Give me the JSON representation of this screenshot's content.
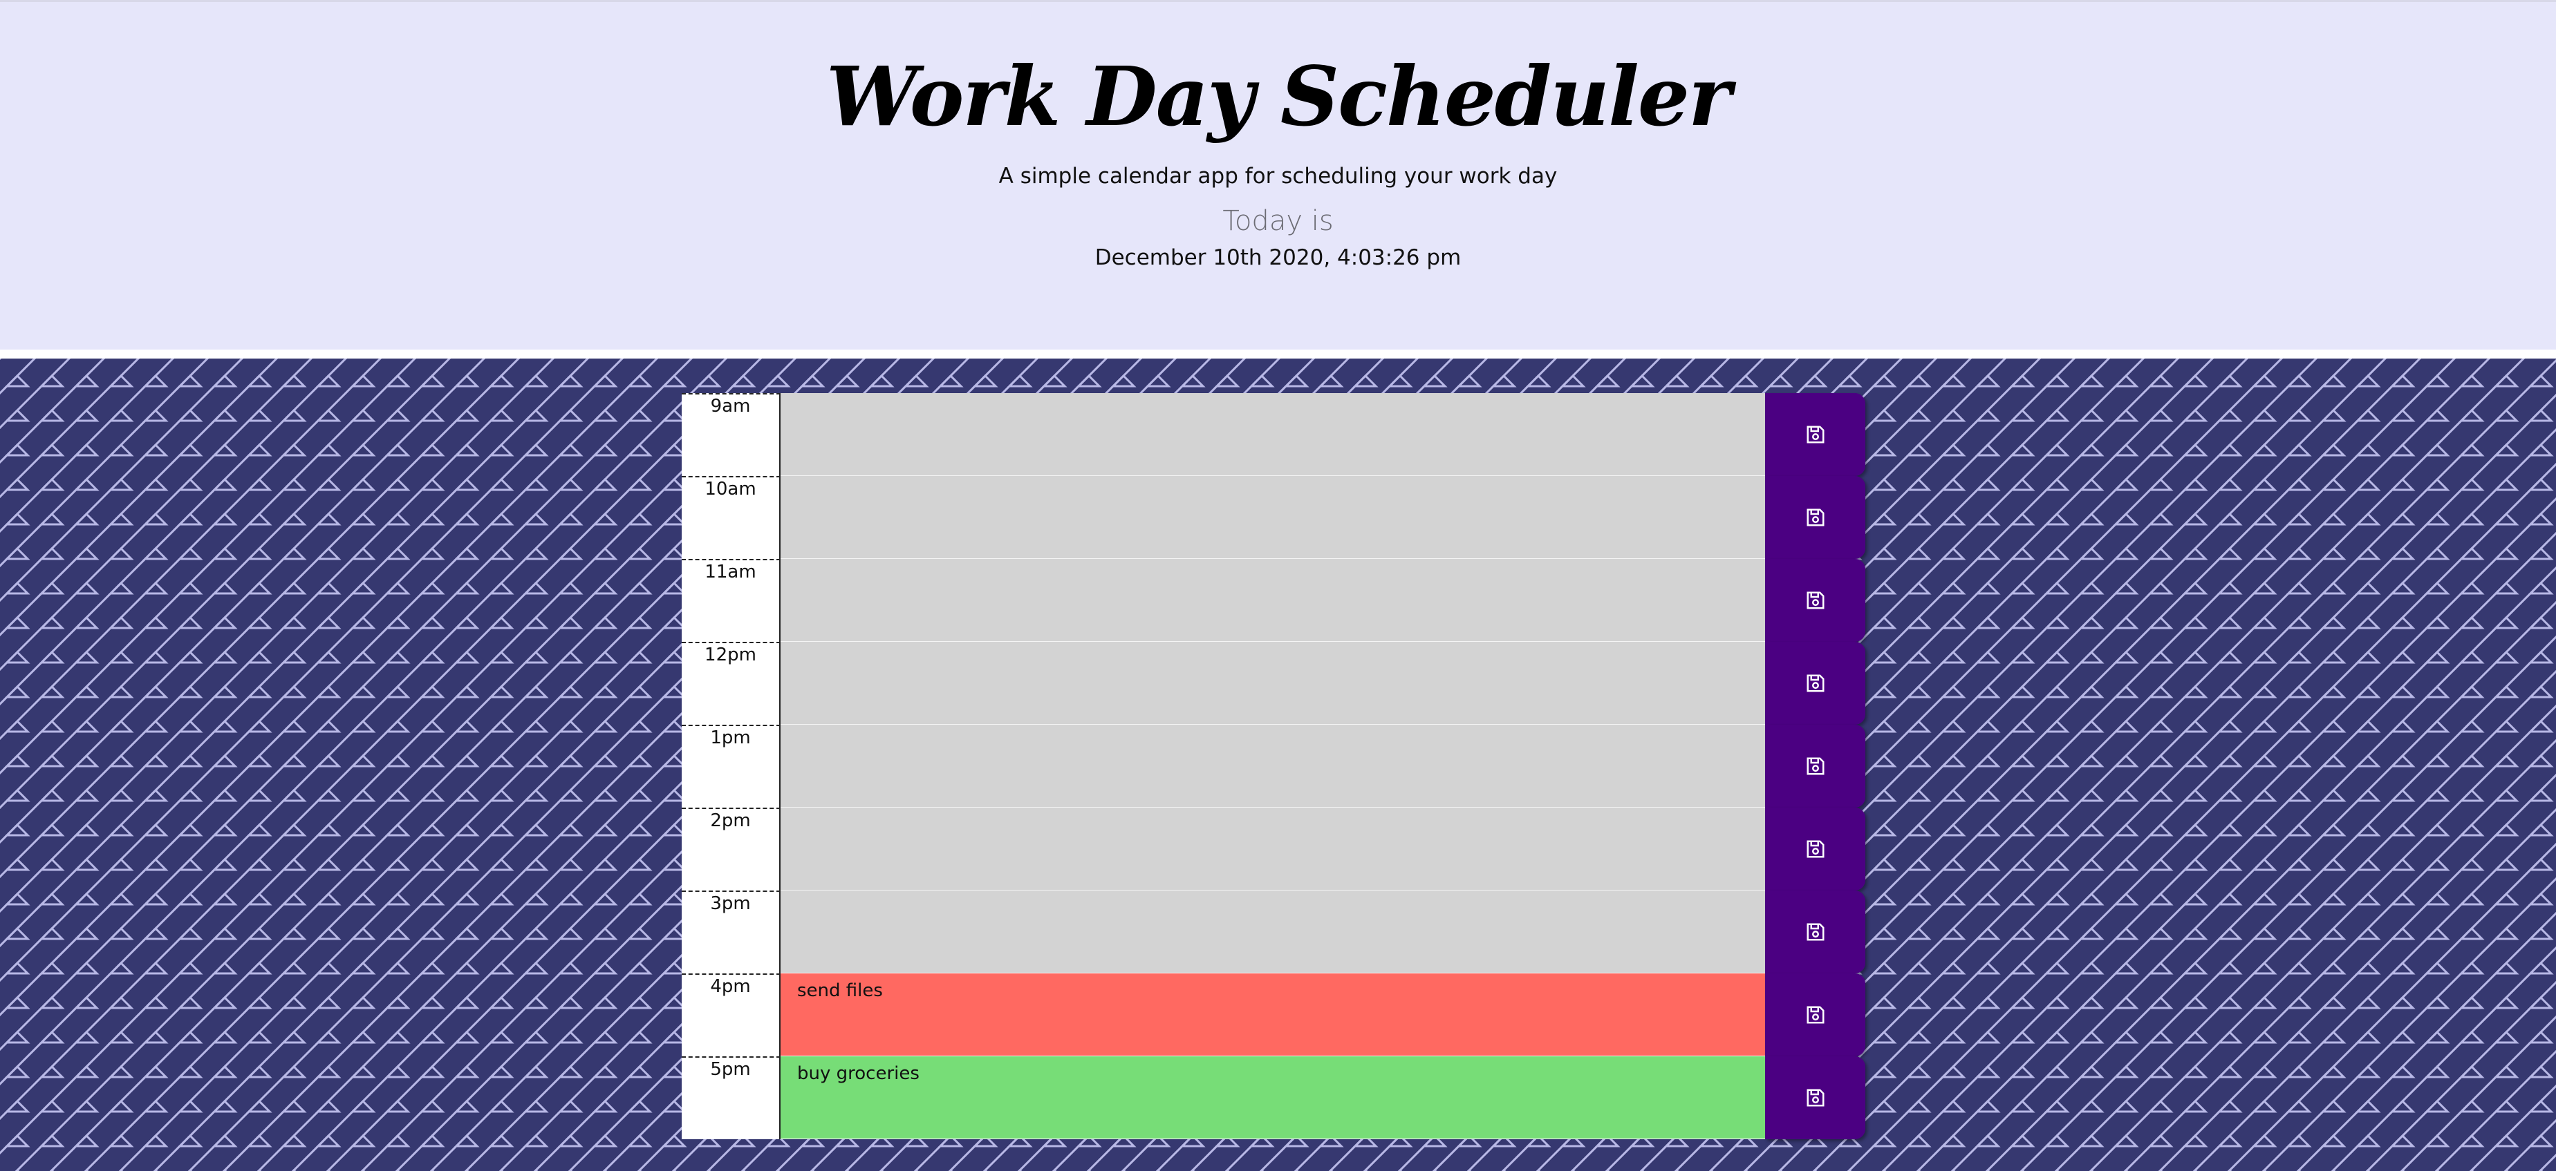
{
  "header": {
    "title": "Work Day Scheduler",
    "subtitle": "A simple calendar app for scheduling your work day",
    "today_label": "Today is",
    "current_day": "December 10th 2020, 4:03:26 pm"
  },
  "colors": {
    "header_bg": "#e6e6fa",
    "pattern_bg": "#363870",
    "past": "#d3d3d3",
    "present": "#ff6961",
    "future": "#77dd77",
    "save_button": "#4b0082"
  },
  "schedule": [
    {
      "hour": "9am",
      "text": "",
      "state": "past"
    },
    {
      "hour": "10am",
      "text": "",
      "state": "past"
    },
    {
      "hour": "11am",
      "text": "",
      "state": "past"
    },
    {
      "hour": "12pm",
      "text": "",
      "state": "past"
    },
    {
      "hour": "1pm",
      "text": "",
      "state": "past"
    },
    {
      "hour": "2pm",
      "text": "",
      "state": "past"
    },
    {
      "hour": "3pm",
      "text": "",
      "state": "past"
    },
    {
      "hour": "4pm",
      "text": "send files",
      "state": "present"
    },
    {
      "hour": "5pm",
      "text": "buy groceries",
      "state": "future"
    }
  ],
  "icons": {
    "save": "save-icon"
  }
}
